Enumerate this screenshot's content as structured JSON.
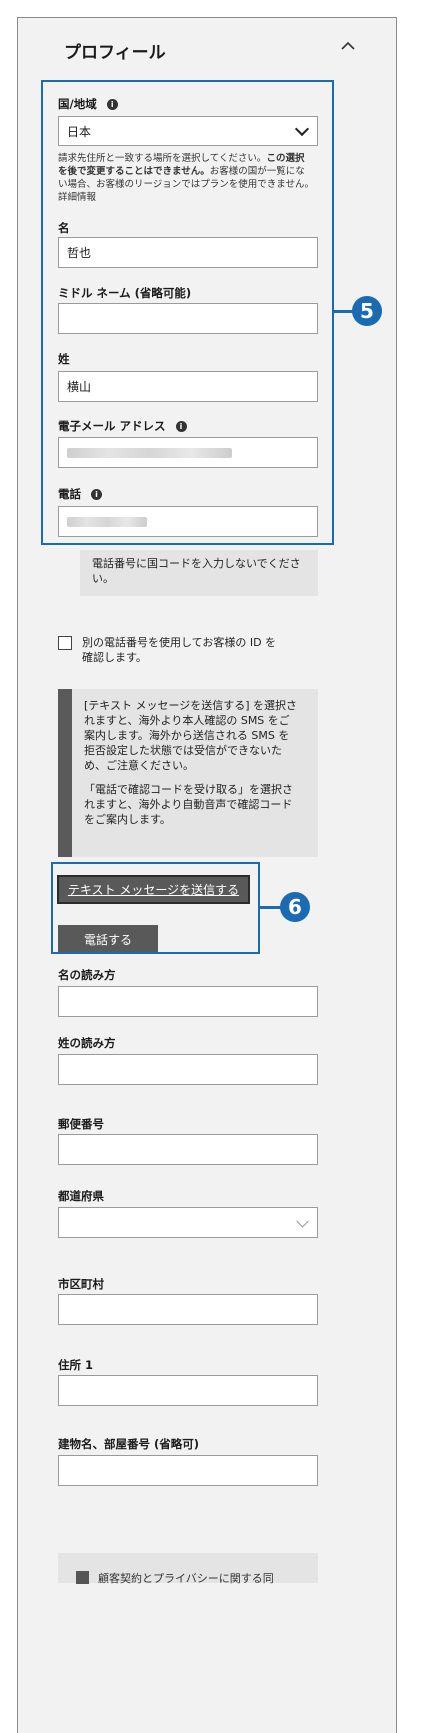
{
  "header": {
    "title": "プロフィール",
    "collapse_icon": "chevron-up-icon"
  },
  "country": {
    "label": "国/地域",
    "value": "日本",
    "help_line1_a": "請求先住所と一致する場所を選択してください。",
    "help_line1_b": "この選択",
    "help_line2_b": "を後で変更することはできません。",
    "help_line2_c": "お客様の国が一覧にな",
    "help_line3": "い場合、お客様のリージョンではプランを使用できません。",
    "details_link": "詳細情報"
  },
  "first_name": {
    "label": "名",
    "value": "哲也"
  },
  "middle_name": {
    "label": "ミドル ネーム (省略可能)",
    "value": ""
  },
  "last_name": {
    "label": "姓",
    "value": "横山"
  },
  "email": {
    "label": "電子メール アドレス"
  },
  "phone": {
    "label": "電話"
  },
  "phone_note": {
    "line1": "電話番号に国コードを入力しないでくださ",
    "line2": "い。"
  },
  "alt_phone": {
    "line1": "別の電話番号を使用してお客様の ID を",
    "line2": "確認します。"
  },
  "sms_note": {
    "p1_l1": "[テキスト メッセージを送信する] を選択さ",
    "p1_l2": "れますと、海外より本人確認の SMS をご",
    "p1_l3": "案内します。海外から送信される SMS を",
    "p1_l4": "拒否設定した状態では受信ができないた",
    "p1_l5": "め、ご注意ください。",
    "p2_l1": "「電話で確認コードを受け取る」を選択さ",
    "p2_l2": "れますと、海外より自動音声で確認コード",
    "p2_l3": "をご案内します。"
  },
  "buttons": {
    "send_sms": "テキスト メッセージを送信する",
    "call": "電話する"
  },
  "first_name_kana": {
    "label": "名の読み方"
  },
  "last_name_kana": {
    "label": "姓の読み方"
  },
  "postal_code": {
    "label": "郵便番号"
  },
  "prefecture": {
    "label": "都道府県"
  },
  "city": {
    "label": "市区町村"
  },
  "address1": {
    "label": "住所 1"
  },
  "building": {
    "label": "建物名、部屋番号 (省略可)"
  },
  "terms": {
    "label": "顧客契約とプライバシーに関する同"
  },
  "callouts": {
    "c5": "5",
    "c6": "6",
    "color": "#1b6bb3"
  }
}
